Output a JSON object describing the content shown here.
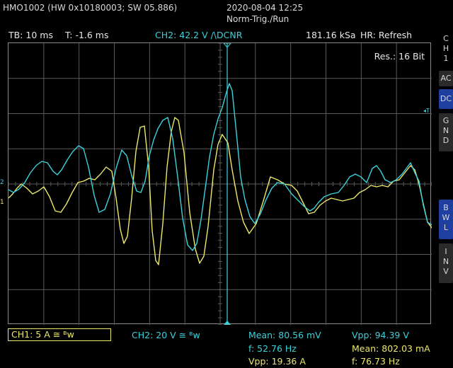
{
  "header": {
    "device_info": "HMO1002 (HW 0x10180003; SW 05.886)",
    "datetime": "2020-08-04 12:25",
    "trigger_mode": "Norm-Trig./Run"
  },
  "status": {
    "timebase": "TB: 10 ms",
    "trigger_time": "T: -1.6 ms",
    "trigger_setting": "CH2: 42.2 V /\\DCNR",
    "sample_rate": "181.16 kSa",
    "acq_mode": "HR: Refresh",
    "resolution": "Res.: 16 Bit"
  },
  "side_menu": {
    "channel": [
      "C",
      "H",
      "1"
    ],
    "ac": "AC",
    "dc": "DC",
    "gnd": [
      "G",
      "N",
      "D"
    ],
    "bwl": [
      "B",
      "W",
      "L"
    ],
    "inv": [
      "I",
      "N",
      "V"
    ],
    "active_color": "#1e3fa0"
  },
  "markers": {
    "ch2_level": "2",
    "ch1_level": "1",
    "trigger_level": "T"
  },
  "footer": {
    "ch1_setting": "CH1: 5 A ≅ ᴮᴡ",
    "ch2_setting": "CH2: 20 V ≅ ᴮᴡ",
    "ch2_mean": "Mean: 80.56 mV",
    "ch2_freq": "f: 52.76 Hz",
    "ch1_vpp": "Vpp: 19.36 A",
    "ch2_vpp": "Vpp: 94.39 V",
    "ch1_mean": "Mean: 802.03 mA",
    "ch1_freq": "f: 76.73 Hz"
  },
  "colors": {
    "ch1": "#ece86a",
    "ch2": "#3cd2dc",
    "grid": "#5a5a5a",
    "background": "#000000"
  },
  "waveforms": {
    "ch2_cyan": [
      [
        0,
        8
      ],
      [
        7,
        12
      ],
      [
        15,
        7
      ],
      [
        23,
        -2
      ],
      [
        31,
        -16
      ],
      [
        39,
        -26
      ],
      [
        47,
        -32
      ],
      [
        55,
        -30
      ],
      [
        63,
        -18
      ],
      [
        69,
        -13
      ],
      [
        75,
        -20
      ],
      [
        83,
        -34
      ],
      [
        91,
        -46
      ],
      [
        99,
        -54
      ],
      [
        106,
        -50
      ],
      [
        113,
        -24
      ],
      [
        121,
        16
      ],
      [
        128,
        40
      ],
      [
        136,
        36
      ],
      [
        144,
        14
      ],
      [
        152,
        -22
      ],
      [
        160,
        -48
      ],
      [
        167,
        -40
      ],
      [
        174,
        -12
      ],
      [
        181,
        10
      ],
      [
        187,
        12
      ],
      [
        193,
        -4
      ],
      [
        199,
        -40
      ],
      [
        205,
        -62
      ],
      [
        211,
        -78
      ],
      [
        218,
        -90
      ],
      [
        225,
        -94
      ],
      [
        232,
        -64
      ],
      [
        239,
        -10
      ],
      [
        246,
        48
      ],
      [
        253,
        86
      ],
      [
        260,
        94
      ],
      [
        266,
        84
      ],
      [
        272,
        50
      ],
      [
        278,
        6
      ],
      [
        284,
        -38
      ],
      [
        290,
        -70
      ],
      [
        296,
        -92
      ],
      [
        302,
        -108
      ],
      [
        308,
        -130
      ],
      [
        312,
        -142
      ],
      [
        316,
        -132
      ],
      [
        322,
        -72
      ],
      [
        328,
        -10
      ],
      [
        334,
        22
      ],
      [
        341,
        46
      ],
      [
        348,
        56
      ],
      [
        356,
        42
      ],
      [
        364,
        22
      ],
      [
        372,
        6
      ],
      [
        380,
        -2
      ],
      [
        390,
        0
      ],
      [
        400,
        14
      ],
      [
        410,
        24
      ],
      [
        418,
        32
      ],
      [
        426,
        38
      ],
      [
        432,
        34
      ],
      [
        438,
        26
      ],
      [
        446,
        18
      ],
      [
        456,
        14
      ],
      [
        466,
        12
      ],
      [
        474,
        2
      ],
      [
        482,
        -10
      ],
      [
        490,
        -14
      ],
      [
        498,
        -10
      ],
      [
        506,
        -2
      ],
      [
        514,
        -22
      ],
      [
        520,
        -26
      ],
      [
        526,
        -18
      ],
      [
        532,
        -6
      ],
      [
        540,
        -2
      ],
      [
        548,
        -6
      ],
      [
        556,
        -14
      ],
      [
        562,
        -22
      ],
      [
        568,
        -30
      ],
      [
        574,
        -16
      ],
      [
        580,
        -4
      ],
      [
        586,
        30
      ],
      [
        592,
        54
      ],
      [
        598,
        58
      ],
      [
        604,
        36
      ],
      [
        608,
        18
      ]
    ],
    "ch1_yellow": [
      [
        0,
        20
      ],
      [
        6,
        14
      ],
      [
        12,
        6
      ],
      [
        18,
        0
      ],
      [
        26,
        6
      ],
      [
        34,
        14
      ],
      [
        42,
        10
      ],
      [
        50,
        4
      ],
      [
        58,
        18
      ],
      [
        66,
        38
      ],
      [
        74,
        40
      ],
      [
        82,
        28
      ],
      [
        90,
        12
      ],
      [
        98,
        -2
      ],
      [
        106,
        -4
      ],
      [
        114,
        -8
      ],
      [
        122,
        -6
      ],
      [
        130,
        -14
      ],
      [
        138,
        -24
      ],
      [
        146,
        -18
      ],
      [
        152,
        20
      ],
      [
        158,
        64
      ],
      [
        163,
        84
      ],
      [
        168,
        74
      ],
      [
        174,
        20
      ],
      [
        180,
        -46
      ],
      [
        186,
        -80
      ],
      [
        192,
        -82
      ],
      [
        198,
        -24
      ],
      [
        203,
        66
      ],
      [
        208,
        108
      ],
      [
        212,
        114
      ],
      [
        218,
        56
      ],
      [
        224,
        -24
      ],
      [
        230,
        -74
      ],
      [
        235,
        -94
      ],
      [
        240,
        -90
      ],
      [
        248,
        -44
      ],
      [
        256,
        40
      ],
      [
        264,
        92
      ],
      [
        270,
        112
      ],
      [
        276,
        102
      ],
      [
        282,
        60
      ],
      [
        290,
        -20
      ],
      [
        296,
        -56
      ],
      [
        302,
        -70
      ],
      [
        310,
        -58
      ],
      [
        316,
        -20
      ],
      [
        324,
        24
      ],
      [
        332,
        54
      ],
      [
        340,
        70
      ],
      [
        350,
        56
      ],
      [
        360,
        24
      ],
      [
        370,
        -10
      ],
      [
        380,
        -6
      ],
      [
        390,
        0
      ],
      [
        400,
        2
      ],
      [
        408,
        10
      ],
      [
        416,
        26
      ],
      [
        424,
        42
      ],
      [
        432,
        40
      ],
      [
        440,
        30
      ],
      [
        448,
        24
      ],
      [
        456,
        20
      ],
      [
        464,
        22
      ],
      [
        472,
        24
      ],
      [
        480,
        22
      ],
      [
        488,
        20
      ],
      [
        496,
        12
      ],
      [
        504,
        8
      ],
      [
        512,
        2
      ],
      [
        520,
        4
      ],
      [
        528,
        2
      ],
      [
        536,
        4
      ],
      [
        544,
        -4
      ],
      [
        552,
        -6
      ],
      [
        560,
        -16
      ],
      [
        568,
        -26
      ],
      [
        574,
        -20
      ],
      [
        580,
        0
      ],
      [
        586,
        28
      ],
      [
        592,
        54
      ],
      [
        598,
        62
      ],
      [
        604,
        40
      ],
      [
        608,
        26
      ]
    ]
  }
}
